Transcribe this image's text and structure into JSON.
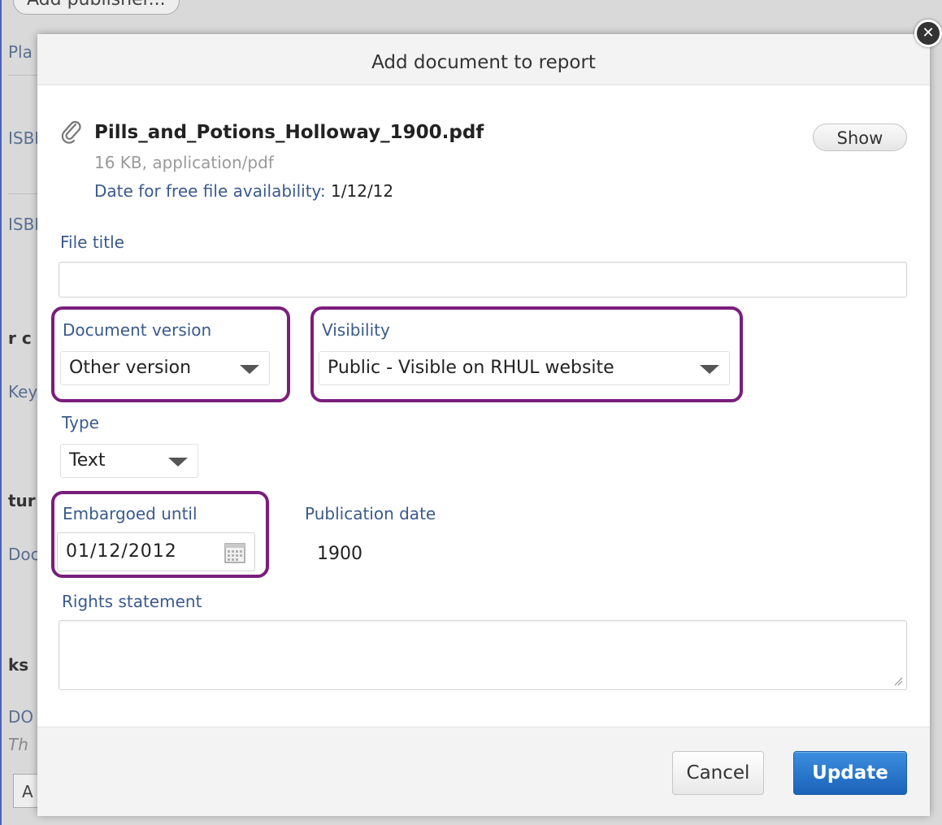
{
  "background": {
    "add_publisher_label": "Add publisher...",
    "fragments": [
      "Pla",
      "ISBI",
      "ISBI",
      "r c",
      "Key",
      "tur",
      "Doc",
      "ks",
      "DO",
      "Th",
      "A"
    ]
  },
  "modal": {
    "title": "Add document to report",
    "file": {
      "name": "Pills_and_Potions_Holloway_1900.pdf",
      "meta": "16 KB, application/pdf",
      "free_date_label": "Date for free file availability:",
      "free_date_value": "1/12/12",
      "show_label": "Show"
    },
    "fields": {
      "file_title_label": "File title",
      "file_title_value": "",
      "document_version_label": "Document version",
      "document_version_value": "Other version",
      "visibility_label": "Visibility",
      "visibility_value": "Public - Visible on RHUL website",
      "type_label": "Type",
      "type_value": "Text",
      "embargoed_label": "Embargoed until",
      "embargoed_value": "01/12/2012",
      "publication_date_label": "Publication date",
      "publication_date_value": "1900",
      "rights_label": "Rights statement",
      "rights_value": ""
    },
    "buttons": {
      "cancel": "Cancel",
      "update": "Update"
    }
  },
  "colors": {
    "label_blue": "#3a5a8c",
    "highlight_purple": "#7a1e7c",
    "update_blue": "#1a62b8"
  },
  "icons": [
    "paperclip-icon",
    "calendar-icon",
    "close-icon",
    "dropdown-arrow-icon",
    "resize-grip-icon"
  ]
}
